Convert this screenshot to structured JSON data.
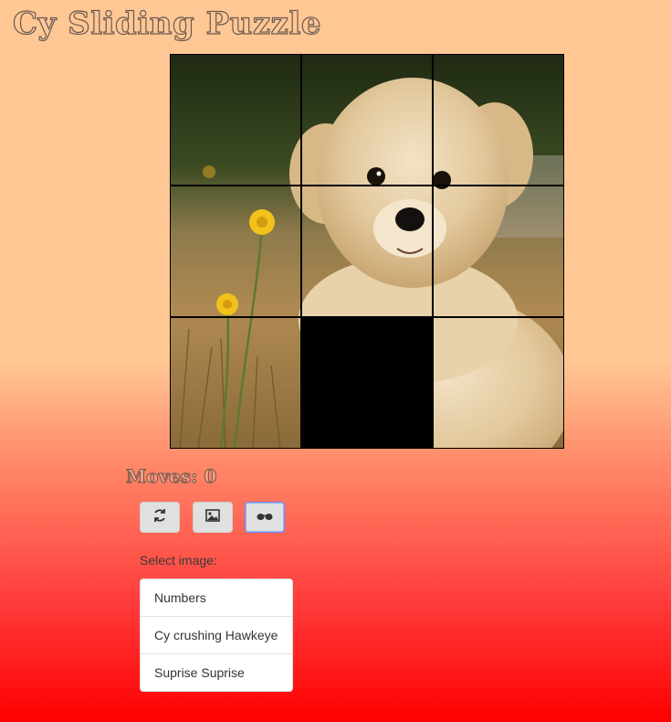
{
  "app": {
    "title": "Cy Sliding Puzzle"
  },
  "game": {
    "moves_label": "Moves: 0",
    "moves": 0,
    "grid_size": 3,
    "empty_tile": "center-bottom"
  },
  "toolbar": {
    "buttons": [
      {
        "name": "shuffle-button",
        "icon": "refresh-icon"
      },
      {
        "name": "show-image-button",
        "icon": "image-icon"
      },
      {
        "name": "peek-button",
        "icon": "sunglasses-icon"
      }
    ]
  },
  "image_select": {
    "label": "Select image:",
    "options": [
      "Numbers",
      "Cy crushing Hawkeye",
      "Suprise Suprise"
    ]
  },
  "colors": {
    "background_top": "#ffc794",
    "background_bottom": "#ff0000",
    "empty_tile": "#000000"
  }
}
